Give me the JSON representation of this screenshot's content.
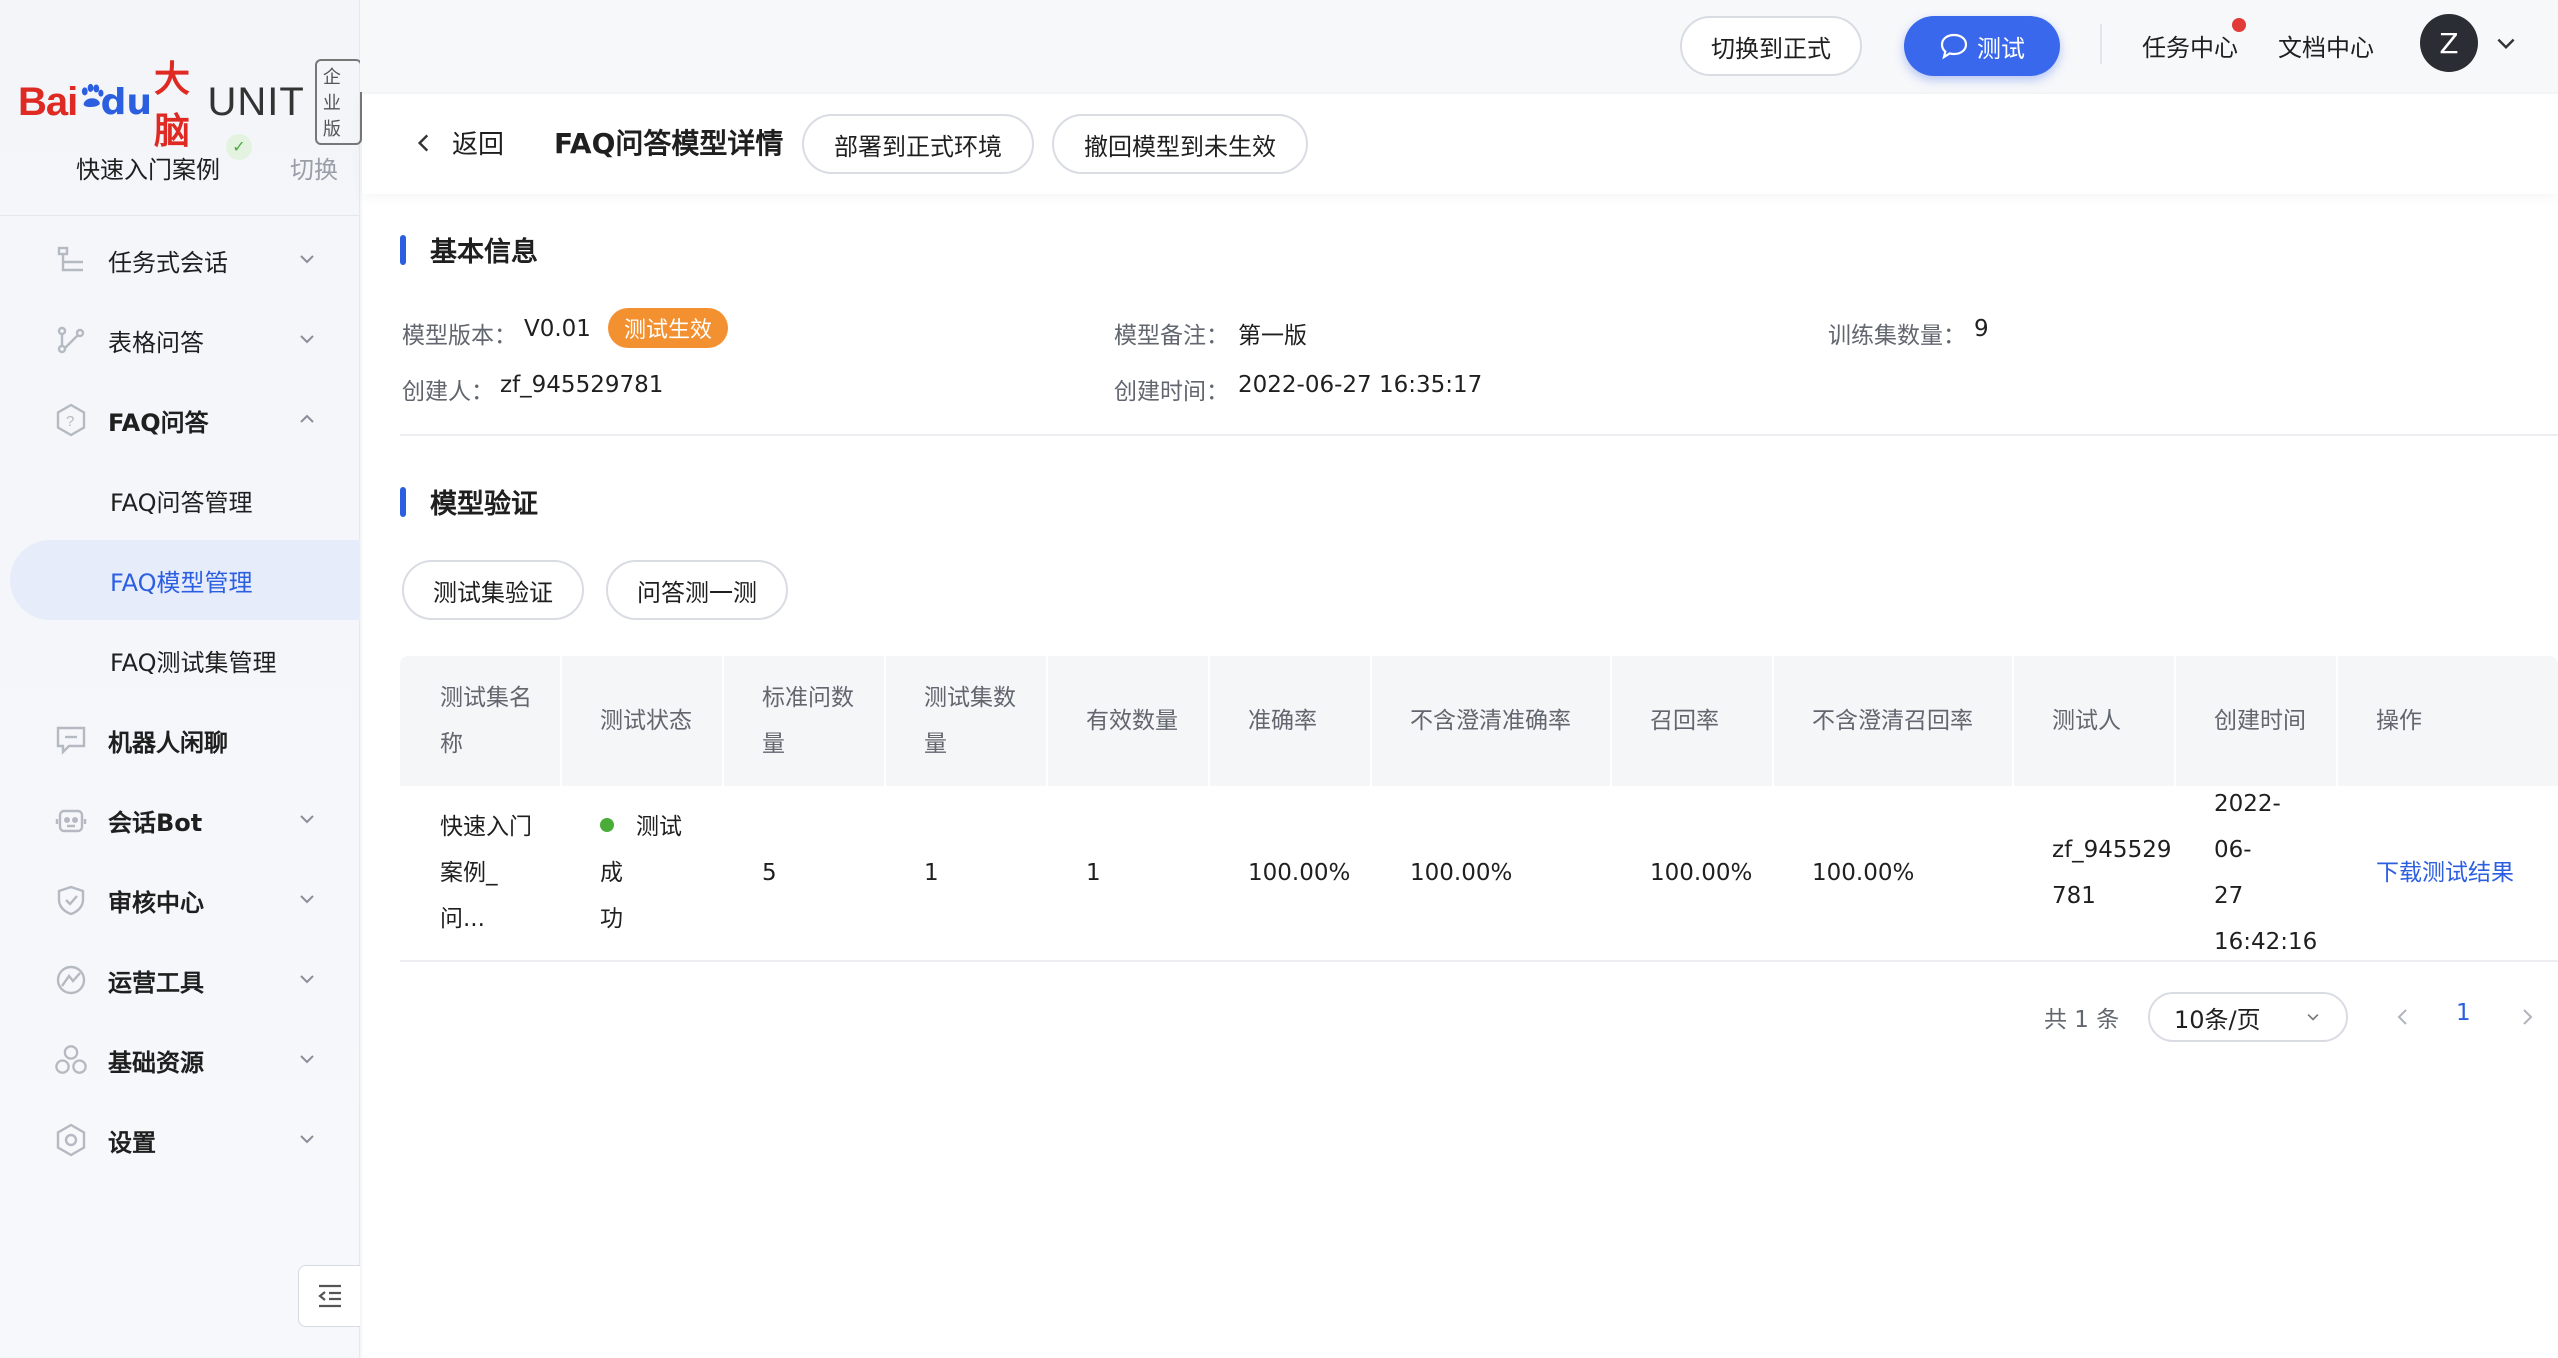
{
  "brand": {
    "bai": "Bai",
    "du": "du",
    "brain": "大脑",
    "unit": "UNIT",
    "edition": "企业版"
  },
  "project": {
    "name": "快速入门案例",
    "switch_label": "切换"
  },
  "sidebar": {
    "items": [
      {
        "label": "任务式会话",
        "icon": "task-dialog-icon",
        "expanded": false
      },
      {
        "label": "表格问答",
        "icon": "table-qa-icon",
        "expanded": false
      },
      {
        "label": "FAQ问答",
        "icon": "faq-icon",
        "expanded": true,
        "children": [
          "FAQ问答管理",
          "FAQ模型管理",
          "FAQ测试集管理"
        ],
        "active_child": "FAQ模型管理"
      },
      {
        "label": "机器人闲聊",
        "icon": "chat-icon"
      },
      {
        "label": "会话Bot",
        "icon": "bot-icon",
        "expanded": false
      },
      {
        "label": "审核中心",
        "icon": "shield-icon",
        "expanded": false
      },
      {
        "label": "运营工具",
        "icon": "ops-icon",
        "expanded": false
      },
      {
        "label": "基础资源",
        "icon": "resource-icon",
        "expanded": false
      },
      {
        "label": "设置",
        "icon": "settings-icon",
        "expanded": false
      }
    ]
  },
  "topbar": {
    "switch_formal": "切换到正式",
    "test": "测试",
    "task_center": "任务中心",
    "doc_center": "文档中心",
    "avatar_letter": "Z"
  },
  "subheader": {
    "back": "返回",
    "title": "FAQ问答模型详情",
    "deploy": "部署到正式环境",
    "revoke": "撤回模型到未生效"
  },
  "basic_info": {
    "section_title": "基本信息",
    "version_label": "模型版本：",
    "version_value": "V0.01",
    "status_tag": "测试生效",
    "note_label": "模型备注：",
    "note_value": "第一版",
    "train_label": "训练集数量：",
    "train_value": "9",
    "creator_label": "创建人：",
    "creator_value": "zf_945529781",
    "created_label": "创建时间：",
    "created_value": "2022-06-27 16:35:17"
  },
  "verify": {
    "section_title": "模型验证",
    "tab_testset": "测试集验证",
    "tab_qa": "问答测一测"
  },
  "table": {
    "headers": [
      {
        "lines": [
          "测试集名",
          "称"
        ]
      },
      {
        "lines": [
          "测试状态"
        ]
      },
      {
        "lines": [
          "标准问数",
          "量"
        ]
      },
      {
        "lines": [
          "测试集数",
          "量"
        ]
      },
      {
        "lines": [
          "有效数量"
        ]
      },
      {
        "lines": [
          "准确率"
        ]
      },
      {
        "lines": [
          "不含澄清准确率"
        ]
      },
      {
        "lines": [
          "召回率"
        ]
      },
      {
        "lines": [
          "不含澄清召回率"
        ]
      },
      {
        "lines": [
          "测试人"
        ]
      },
      {
        "lines": [
          "创建时间"
        ]
      },
      {
        "lines": [
          "操作"
        ]
      }
    ],
    "rows": [
      {
        "name": [
          "快速入门",
          "案例_问..."
        ],
        "status": [
          "测试成",
          "功"
        ],
        "std_count": "5",
        "test_count": "1",
        "valid_count": "1",
        "accuracy": "100.00%",
        "accuracy_no_clarify": "100.00%",
        "recall": "100.00%",
        "recall_no_clarify": "100.00%",
        "tester": [
          "zf_945529",
          "781"
        ],
        "created": [
          "2022-06-",
          "27",
          "16:42:16"
        ],
        "action": "下载测试结果"
      }
    ]
  },
  "pagination": {
    "total": "共 1 条",
    "page_size": "10条/页",
    "current_page": "1"
  },
  "colors": {
    "primary": "#3a68ec",
    "tag_orange": "#f39131",
    "success": "#4aad38"
  }
}
